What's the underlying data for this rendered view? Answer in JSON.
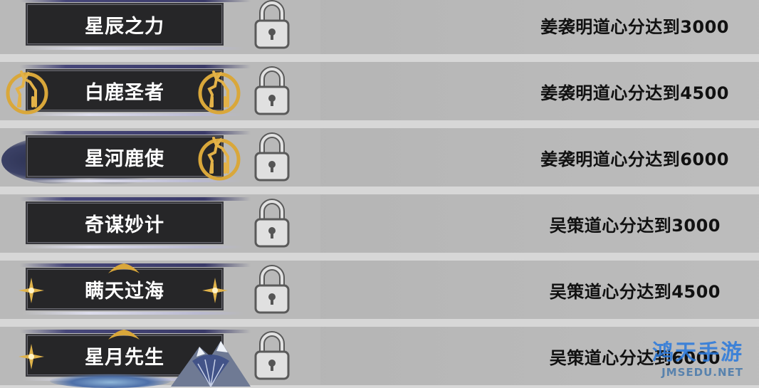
{
  "achievements": [
    {
      "title": "星辰之力",
      "requirement": "姜袭明道心分达到3000"
    },
    {
      "title": "白鹿圣者",
      "requirement": "姜袭明道心分达到4500"
    },
    {
      "title": "星河鹿使",
      "requirement": "姜袭明道心分达到6000"
    },
    {
      "title": "奇谋妙计",
      "requirement": "吴策道心分达到3000"
    },
    {
      "title": "瞒天过海",
      "requirement": "吴策道心分达到4500"
    },
    {
      "title": "星月先生",
      "requirement": "吴策道心分达到6000"
    }
  ],
  "watermark": {
    "brand": "鸿天手游",
    "site": "JMSEDU.NET"
  },
  "colors": {
    "banner": "#262628",
    "gold": "#d9a73a",
    "lock": "#d8d8d8",
    "row": "#b9b9b9"
  },
  "icons": {
    "lock": "padlock-icon",
    "deer": "golden-deer-emblem-icon",
    "star": "golden-star-ornament-icon"
  }
}
